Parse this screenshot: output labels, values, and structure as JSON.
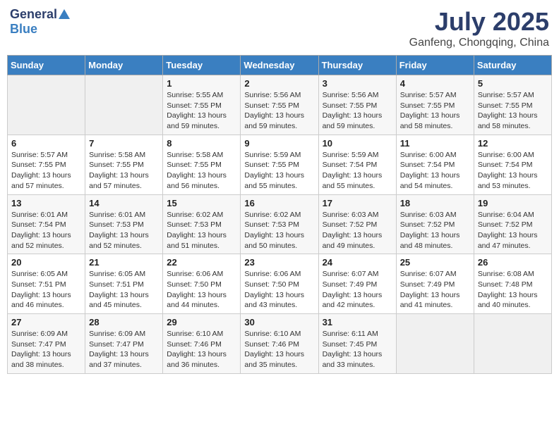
{
  "header": {
    "logo_general": "General",
    "logo_blue": "Blue",
    "month_year": "July 2025",
    "location": "Ganfeng, Chongqing, China"
  },
  "days_of_week": [
    "Sunday",
    "Monday",
    "Tuesday",
    "Wednesday",
    "Thursday",
    "Friday",
    "Saturday"
  ],
  "weeks": [
    [
      {
        "day": "",
        "info": ""
      },
      {
        "day": "",
        "info": ""
      },
      {
        "day": "1",
        "info": "Sunrise: 5:55 AM\nSunset: 7:55 PM\nDaylight: 13 hours and 59 minutes."
      },
      {
        "day": "2",
        "info": "Sunrise: 5:56 AM\nSunset: 7:55 PM\nDaylight: 13 hours and 59 minutes."
      },
      {
        "day": "3",
        "info": "Sunrise: 5:56 AM\nSunset: 7:55 PM\nDaylight: 13 hours and 59 minutes."
      },
      {
        "day": "4",
        "info": "Sunrise: 5:57 AM\nSunset: 7:55 PM\nDaylight: 13 hours and 58 minutes."
      },
      {
        "day": "5",
        "info": "Sunrise: 5:57 AM\nSunset: 7:55 PM\nDaylight: 13 hours and 58 minutes."
      }
    ],
    [
      {
        "day": "6",
        "info": "Sunrise: 5:57 AM\nSunset: 7:55 PM\nDaylight: 13 hours and 57 minutes."
      },
      {
        "day": "7",
        "info": "Sunrise: 5:58 AM\nSunset: 7:55 PM\nDaylight: 13 hours and 57 minutes."
      },
      {
        "day": "8",
        "info": "Sunrise: 5:58 AM\nSunset: 7:55 PM\nDaylight: 13 hours and 56 minutes."
      },
      {
        "day": "9",
        "info": "Sunrise: 5:59 AM\nSunset: 7:55 PM\nDaylight: 13 hours and 55 minutes."
      },
      {
        "day": "10",
        "info": "Sunrise: 5:59 AM\nSunset: 7:54 PM\nDaylight: 13 hours and 55 minutes."
      },
      {
        "day": "11",
        "info": "Sunrise: 6:00 AM\nSunset: 7:54 PM\nDaylight: 13 hours and 54 minutes."
      },
      {
        "day": "12",
        "info": "Sunrise: 6:00 AM\nSunset: 7:54 PM\nDaylight: 13 hours and 53 minutes."
      }
    ],
    [
      {
        "day": "13",
        "info": "Sunrise: 6:01 AM\nSunset: 7:54 PM\nDaylight: 13 hours and 52 minutes."
      },
      {
        "day": "14",
        "info": "Sunrise: 6:01 AM\nSunset: 7:53 PM\nDaylight: 13 hours and 52 minutes."
      },
      {
        "day": "15",
        "info": "Sunrise: 6:02 AM\nSunset: 7:53 PM\nDaylight: 13 hours and 51 minutes."
      },
      {
        "day": "16",
        "info": "Sunrise: 6:02 AM\nSunset: 7:53 PM\nDaylight: 13 hours and 50 minutes."
      },
      {
        "day": "17",
        "info": "Sunrise: 6:03 AM\nSunset: 7:52 PM\nDaylight: 13 hours and 49 minutes."
      },
      {
        "day": "18",
        "info": "Sunrise: 6:03 AM\nSunset: 7:52 PM\nDaylight: 13 hours and 48 minutes."
      },
      {
        "day": "19",
        "info": "Sunrise: 6:04 AM\nSunset: 7:52 PM\nDaylight: 13 hours and 47 minutes."
      }
    ],
    [
      {
        "day": "20",
        "info": "Sunrise: 6:05 AM\nSunset: 7:51 PM\nDaylight: 13 hours and 46 minutes."
      },
      {
        "day": "21",
        "info": "Sunrise: 6:05 AM\nSunset: 7:51 PM\nDaylight: 13 hours and 45 minutes."
      },
      {
        "day": "22",
        "info": "Sunrise: 6:06 AM\nSunset: 7:50 PM\nDaylight: 13 hours and 44 minutes."
      },
      {
        "day": "23",
        "info": "Sunrise: 6:06 AM\nSunset: 7:50 PM\nDaylight: 13 hours and 43 minutes."
      },
      {
        "day": "24",
        "info": "Sunrise: 6:07 AM\nSunset: 7:49 PM\nDaylight: 13 hours and 42 minutes."
      },
      {
        "day": "25",
        "info": "Sunrise: 6:07 AM\nSunset: 7:49 PM\nDaylight: 13 hours and 41 minutes."
      },
      {
        "day": "26",
        "info": "Sunrise: 6:08 AM\nSunset: 7:48 PM\nDaylight: 13 hours and 40 minutes."
      }
    ],
    [
      {
        "day": "27",
        "info": "Sunrise: 6:09 AM\nSunset: 7:47 PM\nDaylight: 13 hours and 38 minutes."
      },
      {
        "day": "28",
        "info": "Sunrise: 6:09 AM\nSunset: 7:47 PM\nDaylight: 13 hours and 37 minutes."
      },
      {
        "day": "29",
        "info": "Sunrise: 6:10 AM\nSunset: 7:46 PM\nDaylight: 13 hours and 36 minutes."
      },
      {
        "day": "30",
        "info": "Sunrise: 6:10 AM\nSunset: 7:46 PM\nDaylight: 13 hours and 35 minutes."
      },
      {
        "day": "31",
        "info": "Sunrise: 6:11 AM\nSunset: 7:45 PM\nDaylight: 13 hours and 33 minutes."
      },
      {
        "day": "",
        "info": ""
      },
      {
        "day": "",
        "info": ""
      }
    ]
  ]
}
